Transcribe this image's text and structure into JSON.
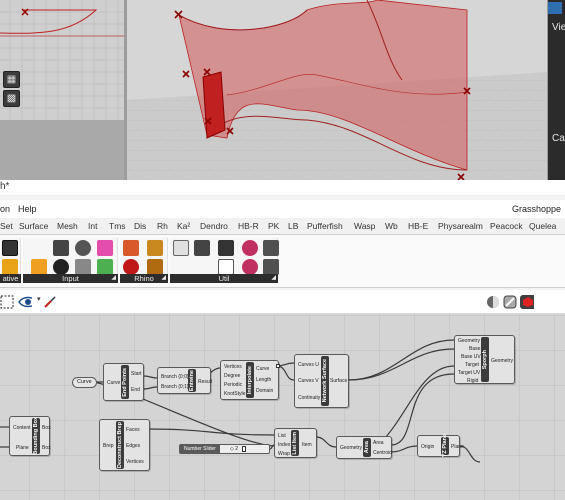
{
  "rhino_panel": {
    "view_label": "Vie",
    "ca_label": "Ca"
  },
  "window_title": "h*",
  "menu": {
    "items": [
      "on",
      "Help"
    ],
    "app_name": "Grasshoppe"
  },
  "tabs": [
    {
      "label": "Set"
    },
    {
      "label": "Surface"
    },
    {
      "label": "Mesh"
    },
    {
      "label": "Int"
    },
    {
      "label": "Tms"
    },
    {
      "label": "Dis"
    },
    {
      "label": "Rh"
    },
    {
      "label": "Ka²"
    },
    {
      "label": "Dendro"
    },
    {
      "label": "HB-R"
    },
    {
      "label": "PK"
    },
    {
      "label": "LB"
    },
    {
      "label": "Pufferfish"
    },
    {
      "label": "Wasp"
    },
    {
      "label": "Wb"
    },
    {
      "label": "HB-E"
    },
    {
      "label": "Physarealm"
    },
    {
      "label": "Peacock"
    },
    {
      "label": "Quelea"
    }
  ],
  "ribbon_groups": [
    {
      "label": "ative"
    },
    {
      "label": "Input"
    },
    {
      "label": "Rhino"
    },
    {
      "label": "Util"
    }
  ],
  "components": {
    "end_points": {
      "name": "End Points",
      "inputs": [
        "Curve"
      ],
      "outputs": [
        "Start",
        "End"
      ]
    },
    "entwine": {
      "name": "Entwine",
      "inputs": [
        "Branch {0;0}",
        "Branch {0;1}"
      ],
      "outputs": [
        "Result"
      ]
    },
    "interpolate": {
      "name": "Interpolate",
      "inputs": [
        "Vertices",
        "Degree",
        "Periodic",
        "KnotStyle"
      ],
      "outputs": [
        "Curve",
        "Length",
        "Domain"
      ]
    },
    "network_surface": {
      "name": "Network Surface",
      "inputs": [
        "Curves U",
        "Curves V",
        "Continuity"
      ],
      "outputs": [
        "Surface"
      ]
    },
    "sporph": {
      "name": "Sporph",
      "inputs": [
        "Geometry",
        "Base",
        "Base UV",
        "Target",
        "Target UV",
        "Rigid"
      ],
      "outputs": [
        "Geometry"
      ]
    },
    "bounding_box": {
      "name": "Bounding Box",
      "inputs": [
        "Content",
        "Plane"
      ],
      "outputs": [
        "Box",
        "Box"
      ]
    },
    "deconstruct_brep": {
      "name": "Deconstruct Brep",
      "inputs": [
        "Brep"
      ],
      "outputs": [
        "Faces",
        "Edges",
        "Vertices"
      ]
    },
    "list_item": {
      "name": "List Item",
      "inputs": [
        "List",
        "Index",
        "Wrap"
      ],
      "outputs": [
        "Item"
      ]
    },
    "area": {
      "name": "Area",
      "inputs": [
        "Geometry"
      ],
      "outputs": [
        "Area",
        "Centroid"
      ]
    },
    "yz_plane": {
      "name": "YZ Plane",
      "inputs": [
        "Origin"
      ],
      "outputs": [
        "Plane"
      ]
    }
  },
  "params": {
    "curve_param": "Curve"
  },
  "number_slider": {
    "label": "Number Slider",
    "value": "◇ 2",
    "level": 0.4
  }
}
